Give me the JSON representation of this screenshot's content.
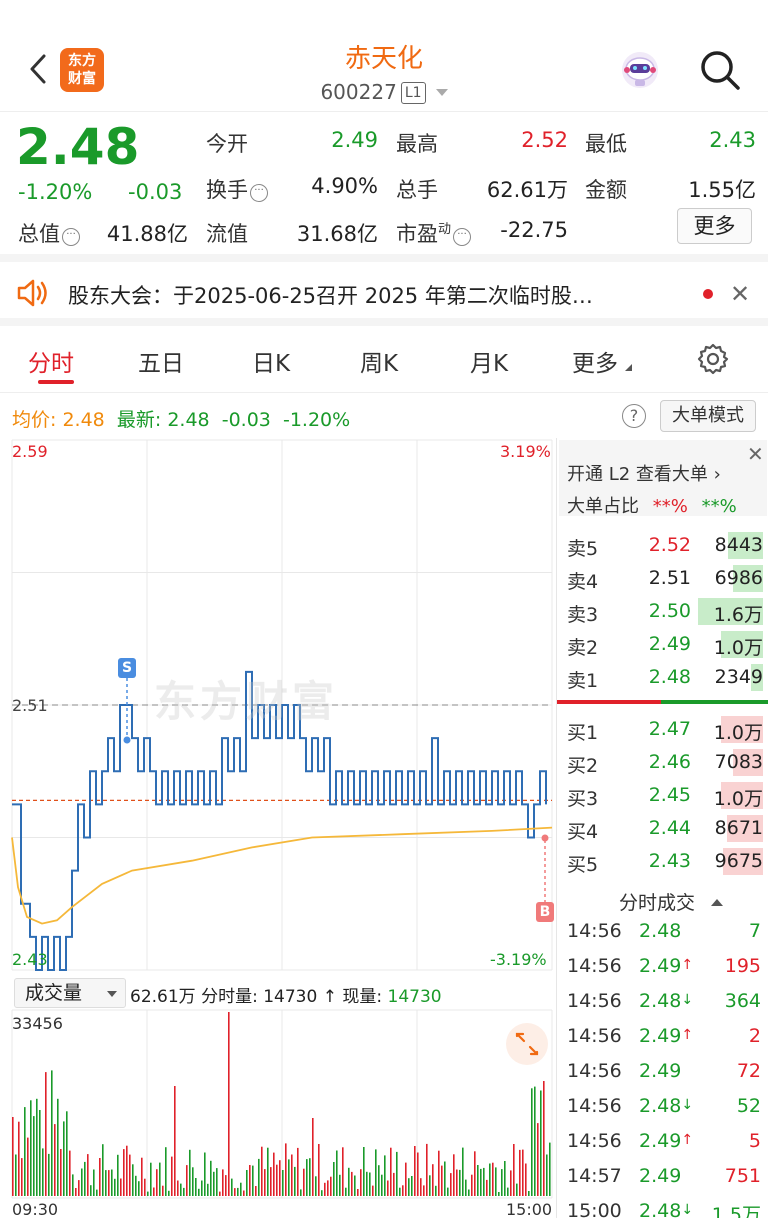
{
  "header": {
    "logo_line1": "东方",
    "logo_line2": "财富",
    "title": "赤天化",
    "code": "600227",
    "level_badge": "L1",
    "icons": [
      "back-icon",
      "robot-icon",
      "search-icon"
    ]
  },
  "quote": {
    "price": "2.48",
    "change_pct": "-1.20%",
    "change": "-0.03",
    "open_label": "今开",
    "open": "2.49",
    "high_label": "最高",
    "high": "2.52",
    "low_label": "最低",
    "low": "2.43",
    "turnover_label": "换手",
    "turnover": "4.90%",
    "volume_label": "总手",
    "volume": "62.61万",
    "amount_label": "金额",
    "amount": "1.55亿",
    "mktcap_label": "总值",
    "mktcap": "41.88亿",
    "float_label": "流值",
    "float": "31.68亿",
    "pe_label": "市盈",
    "pe_sup": "动",
    "pe": "-22.75",
    "more_label": "更多"
  },
  "notice": {
    "text": "股东大会：于2025-06-25召开 2025 年第二次临时股…"
  },
  "tabs": {
    "items": [
      "分时",
      "五日",
      "日K",
      "周K",
      "月K",
      "更多"
    ],
    "active": "分时"
  },
  "info": {
    "avg_label": "均价:",
    "avg": "2.48",
    "latest_label": "最新:",
    "latest": "2.48",
    "chg": "-0.03",
    "chg_pct": "-1.20%",
    "help": "?",
    "mode_label": "大单模式"
  },
  "chart_labels": {
    "price_top": "2.59",
    "pct_top": "3.19%",
    "price_bottom": "2.43",
    "pct_bottom": "-3.19%",
    "ref_price": "2.51",
    "s_marker": "S",
    "b_marker": "B",
    "watermark": "东方财富",
    "vol_top": "33456",
    "time_start": "09:30",
    "time_end": "15:00"
  },
  "volume_bar": {
    "selector": "成交量",
    "total": "62.61万",
    "minute_label": "分时量:",
    "minute_val": "14730",
    "now_label": "现量:",
    "now_val": "14730"
  },
  "book": {
    "l2_link": "开通 L2 查看大单 ›",
    "big_label": "大单占比",
    "big_buy": "**%",
    "big_sell": "**%",
    "asks": [
      {
        "label": "卖5",
        "price": "2.52",
        "vol": "8443",
        "fill": 0.35
      },
      {
        "label": "卖4",
        "price": "2.51",
        "vol": "6986",
        "fill": 0.3
      },
      {
        "label": "卖3",
        "price": "2.50",
        "vol": "1.6万",
        "fill": 0.65
      },
      {
        "label": "卖2",
        "price": "2.49",
        "vol": "1.0万",
        "fill": 0.42
      },
      {
        "label": "卖1",
        "price": "2.48",
        "vol": "2349",
        "fill": 0.12
      }
    ],
    "bids": [
      {
        "label": "买1",
        "price": "2.47",
        "vol": "1.0万",
        "fill": 0.42
      },
      {
        "label": "买2",
        "price": "2.46",
        "vol": "7083",
        "fill": 0.3
      },
      {
        "label": "买3",
        "price": "2.45",
        "vol": "1.0万",
        "fill": 0.42
      },
      {
        "label": "买4",
        "price": "2.44",
        "vol": "8671",
        "fill": 0.36
      },
      {
        "label": "买5",
        "price": "2.43",
        "vol": "9675",
        "fill": 0.4
      }
    ],
    "trades_title": "分时成交",
    "trades": [
      {
        "time": "14:56",
        "price": "2.48",
        "dir": "",
        "vol": "7",
        "color": "green"
      },
      {
        "time": "14:56",
        "price": "2.49",
        "dir": "↑",
        "vol": "195",
        "color": "red"
      },
      {
        "time": "14:56",
        "price": "2.48",
        "dir": "↓",
        "vol": "364",
        "color": "green"
      },
      {
        "time": "14:56",
        "price": "2.49",
        "dir": "↑",
        "vol": "2",
        "color": "red"
      },
      {
        "time": "14:56",
        "price": "2.49",
        "dir": "",
        "vol": "72",
        "color": "red"
      },
      {
        "time": "14:56",
        "price": "2.48",
        "dir": "↓",
        "vol": "52",
        "color": "green"
      },
      {
        "time": "14:56",
        "price": "2.49",
        "dir": "↑",
        "vol": "5",
        "color": "red"
      },
      {
        "time": "14:57",
        "price": "2.49",
        "dir": "",
        "vol": "751",
        "color": "red"
      },
      {
        "time": "15:00",
        "price": "2.48",
        "dir": "↓",
        "vol": "1.5万",
        "color": "green"
      }
    ]
  },
  "colors": {
    "up": "#e0212a",
    "down": "#1a9a2a",
    "brand": "#f06a12",
    "price_line": "#2e6db4",
    "avg_line": "#f5b83a"
  }
}
